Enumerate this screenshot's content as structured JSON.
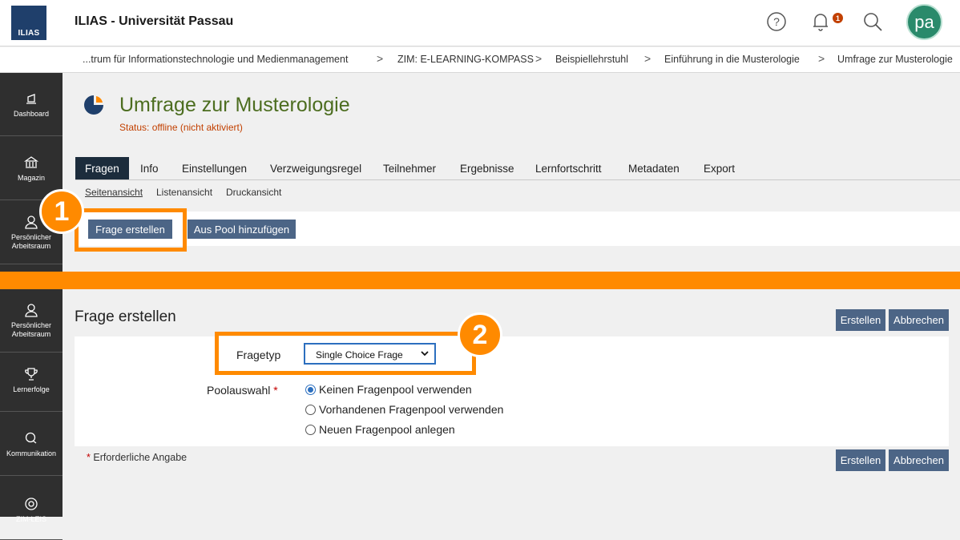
{
  "header": {
    "logo_text": "ILIAS",
    "app_title": "ILIAS - Universität Passau",
    "notification_count": "1",
    "avatar_initials": "pa",
    "icons": [
      "help-icon",
      "bell-icon",
      "search-icon"
    ]
  },
  "breadcrumb": [
    "...trum für Informationstechnologie und Medienmanagement",
    "ZIM: E-LEARNING-KOMPASS",
    "Beispiellehrstuhl",
    "Einführung in die Musterologie",
    "Umfrage zur Musterologie"
  ],
  "sidebar": {
    "items": [
      {
        "label": "Dashboard",
        "icon": "dashboard-icon"
      },
      {
        "label": "Magazin",
        "icon": "repository-icon"
      },
      {
        "label": "Persönlicher Arbeitsraum",
        "icon": "user-icon"
      },
      {
        "label": "Persönlicher Arbeitsraum",
        "icon": "user-icon"
      },
      {
        "label": "Lernerfolge",
        "icon": "trophy-icon"
      },
      {
        "label": "Kommunikation",
        "icon": "chat-icon"
      },
      {
        "label": "ZIM-LEIS",
        "icon": "lifebuoy-icon"
      }
    ]
  },
  "page": {
    "title": "Umfrage zur Musterologie",
    "status": "Status: offline (nicht aktiviert)"
  },
  "tabs": [
    "Fragen",
    "Info",
    "Einstellungen",
    "Verzweigungsregel",
    "Teilnehmer",
    "Ergebnisse",
    "Lernfortschritt",
    "Metadaten",
    "Export"
  ],
  "subtabs": [
    "Seitenansicht",
    "Listenansicht",
    "Druckansicht"
  ],
  "toolbar": {
    "create_question": "Frage erstellen",
    "add_from_pool": "Aus Pool hinzufügen"
  },
  "markers": [
    "1",
    "2"
  ],
  "form": {
    "title": "Frage erstellen",
    "submit": "Erstellen",
    "cancel": "Abbrechen",
    "question_type_label": "Fragetyp",
    "question_type_value": "Single Choice Frage",
    "pool_label": "Poolauswahl",
    "required_mark": "*",
    "pool_options": [
      {
        "label": "Keinen Fragenpool verwenden",
        "checked": true
      },
      {
        "label": "Vorhandenen Fragenpool verwenden",
        "checked": false
      },
      {
        "label": "Neuen Fragenpool anlegen",
        "checked": false
      }
    ],
    "required_note": "Erforderliche Angabe"
  },
  "colors": {
    "accent_orange": "#ff8a00",
    "title_green": "#4c6d1f",
    "button_blue": "#4c6586",
    "status_red": "#c24000"
  }
}
